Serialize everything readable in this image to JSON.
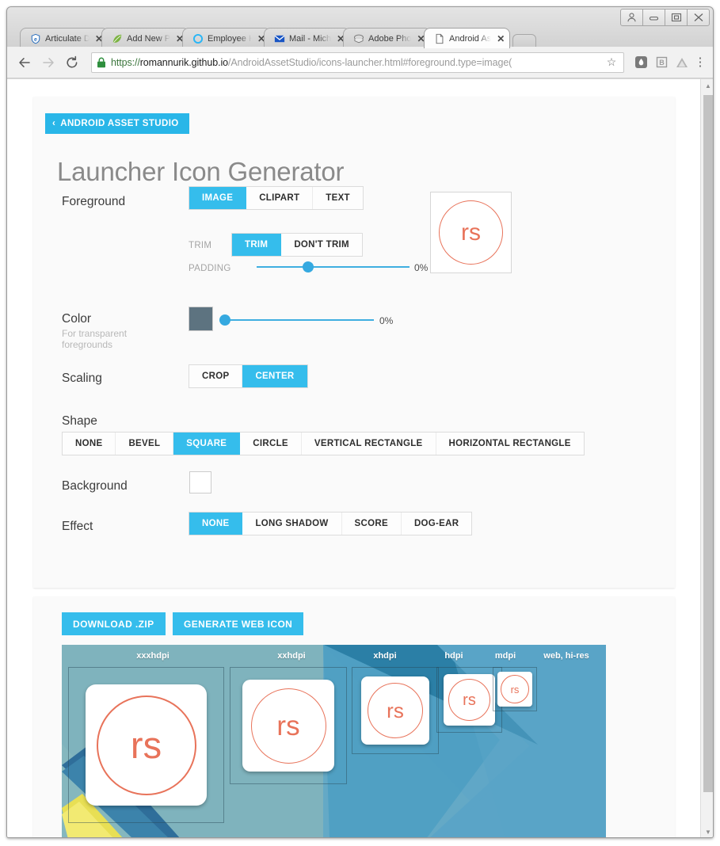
{
  "browser": {
    "window_controls": [
      {
        "name": "user-avatar-button",
        "glyph": "A"
      },
      {
        "name": "minimize-button",
        "glyph": "—"
      },
      {
        "name": "maximize-button",
        "glyph": "□"
      },
      {
        "name": "close-button",
        "glyph": "✕"
      }
    ],
    "tabs": [
      {
        "title": "Articulate D",
        "favicon": "shield-icon",
        "active": false
      },
      {
        "title": "Add New P",
        "favicon": "leaf-icon",
        "active": false
      },
      {
        "title": "Employee H",
        "favicon": "circle-icon",
        "active": false
      },
      {
        "title": "Mail - Mich",
        "favicon": "envelope-icon",
        "active": false
      },
      {
        "title": "Adobe Pho",
        "favicon": "adobe-icon",
        "active": false
      },
      {
        "title": "Android As",
        "favicon": "page-icon",
        "active": true
      }
    ],
    "close_glyph": "✕",
    "nav": {
      "back_glyph": "←",
      "forward_glyph": "→",
      "reload_glyph": "⟳"
    },
    "omnibox": {
      "scheme": "https://",
      "host": "romannurik.github.io",
      "path": "/AndroidAssetStudio/icons-launcher.html#foreground.type=image(",
      "star_glyph": "☆",
      "lock_icon": "lock-icon"
    },
    "extensions": [
      "extension-icon-1",
      "extension-icon-2",
      "google-drive-icon"
    ],
    "menu_glyph": "⋮",
    "scrollbar": {
      "up_glyph": "▲",
      "down_glyph": "▼"
    }
  },
  "page": {
    "back_link": "ANDROID ASSET STUDIO",
    "back_chevron": "‹",
    "title": "Launcher Icon Generator",
    "foreground": {
      "label": "Foreground",
      "options": [
        "IMAGE",
        "CLIPART",
        "TEXT"
      ],
      "selected": "IMAGE",
      "trim_label": "TRIM",
      "trim_options": [
        "TRIM",
        "DON'T TRIM"
      ],
      "trim_selected": "TRIM",
      "padding_label": "PADDING",
      "padding_value": "0%"
    },
    "color": {
      "label": "Color",
      "sub": "For transparent foregrounds",
      "swatch_hex": "#5d7380",
      "value": "0%"
    },
    "scaling": {
      "label": "Scaling",
      "options": [
        "CROP",
        "CENTER"
      ],
      "selected": "CENTER"
    },
    "shape": {
      "label": "Shape",
      "options": [
        "NONE",
        "BEVEL",
        "SQUARE",
        "CIRCLE",
        "VERTICAL RECTANGLE",
        "HORIZONTAL RECTANGLE"
      ],
      "selected": "SQUARE"
    },
    "background": {
      "label": "Background",
      "swatch_hex": "#ffffff"
    },
    "effect": {
      "label": "Effect",
      "options": [
        "NONE",
        "LONG SHADOW",
        "SCORE",
        "DOG-EAR"
      ],
      "selected": "NONE"
    },
    "actions": {
      "download_label": "DOWNLOAD .ZIP",
      "generate_label": "GENERATE WEB ICON"
    },
    "preview": {
      "icon_text": "rs",
      "icon_color": "#e8735a",
      "densities": [
        "xxxhdpi",
        "xxhdpi",
        "xhdpi",
        "hdpi",
        "mdpi",
        "web, hi-res"
      ]
    },
    "accent_hex": "#35bdec"
  }
}
